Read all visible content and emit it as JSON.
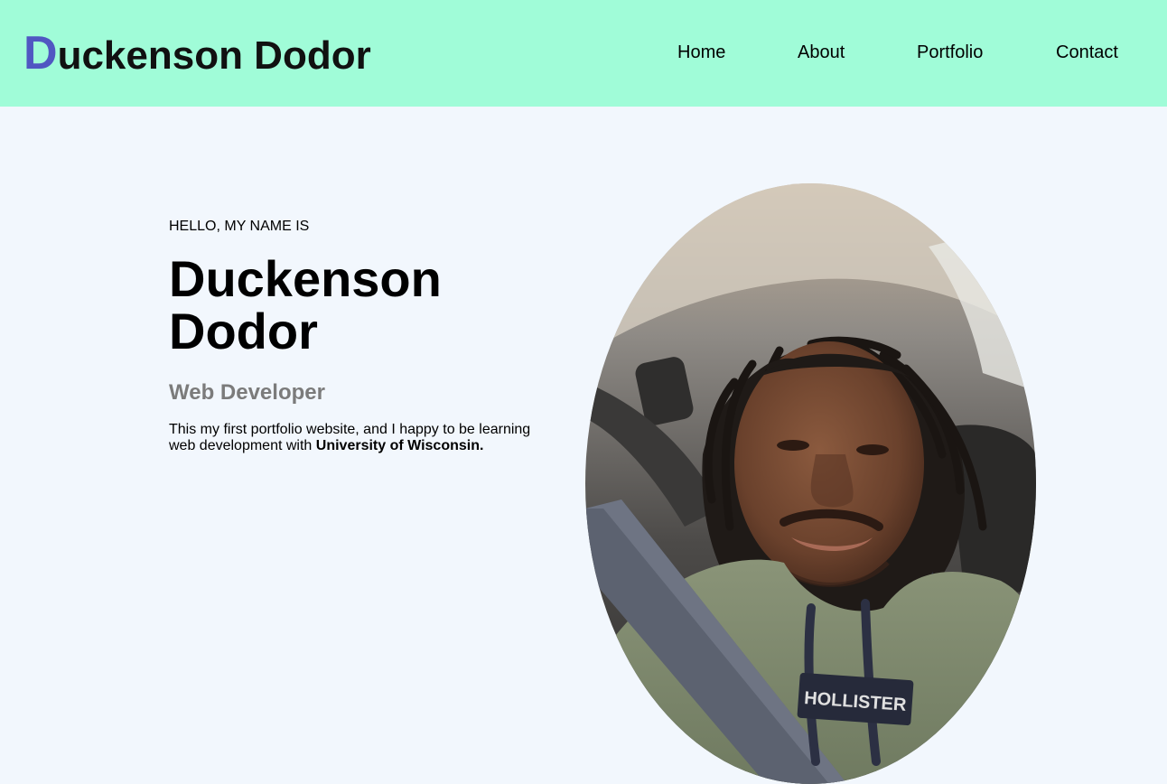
{
  "header": {
    "logo_initial": "D",
    "logo_rest": "uckenson Dodor",
    "nav": [
      {
        "label": "Home"
      },
      {
        "label": "About"
      },
      {
        "label": "Portfolio"
      },
      {
        "label": "Contact"
      }
    ]
  },
  "hero": {
    "greeting": "HELLO, MY NAME IS",
    "name_line1": "Duckenson",
    "name_line2": "Dodor",
    "role": "Web Developer",
    "description_start": "This my first portfolio website, and I happy to be learning web development with ",
    "description_bold": "University of Wisconsin.",
    "hoodie_text": "HOLLISTER"
  },
  "colors": {
    "header_bg": "#a0fcd8",
    "page_bg": "#f2f7fd",
    "logo_accent": "#5057c2",
    "role_text": "#7b7b7b"
  }
}
